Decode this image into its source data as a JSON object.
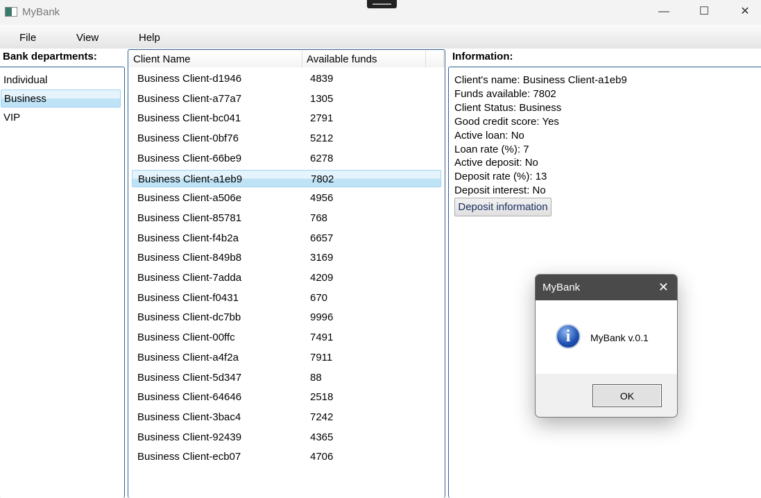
{
  "window": {
    "title": "MyBank",
    "minimize": "—",
    "maximize": "☐",
    "close": "✕"
  },
  "menu": [
    "File",
    "View",
    "Help"
  ],
  "departments": {
    "header": "Bank departments:",
    "items": [
      "Individual",
      "Business",
      "VIP"
    ],
    "selected": 1
  },
  "clients": {
    "columns": [
      "Client Name",
      "Available funds"
    ],
    "selected": 5,
    "rows": [
      [
        "Business Client-d1946",
        "4839"
      ],
      [
        "Business Client-a77a7",
        "1305"
      ],
      [
        "Business Client-bc041",
        "2791"
      ],
      [
        "Business Client-0bf76",
        "5212"
      ],
      [
        "Business Client-66be9",
        "6278"
      ],
      [
        "Business Client-a1eb9",
        "7802"
      ],
      [
        "Business Client-a506e",
        "4956"
      ],
      [
        "Business Client-85781",
        "768"
      ],
      [
        "Business Client-f4b2a",
        "6657"
      ],
      [
        "Business Client-849b8",
        "3169"
      ],
      [
        "Business Client-7adda",
        "4209"
      ],
      [
        "Business Client-f0431",
        "670"
      ],
      [
        "Business Client-dc7bb",
        "9996"
      ],
      [
        "Business Client-00ffc",
        "7491"
      ],
      [
        "Business Client-a4f2a",
        "7911"
      ],
      [
        "Business Client-5d347",
        "88"
      ],
      [
        "Business Client-64646",
        "2518"
      ],
      [
        "Business Client-3bac4",
        "7242"
      ],
      [
        "Business Client-92439",
        "4365"
      ],
      [
        "Business Client-ecb07",
        "4706"
      ]
    ]
  },
  "information": {
    "header": "Information:",
    "lines": [
      "Client's name: Business Client-a1eb9",
      "Funds available: 7802",
      "Client Status: Business",
      "Good credit score: Yes",
      "Active loan: No",
      "Loan rate (%): 7",
      "Active deposit: No",
      "Deposit rate (%): 13",
      "Deposit interest: No"
    ],
    "button": "Deposit information"
  },
  "dialog": {
    "title": "MyBank",
    "close": "✕",
    "icon": "i",
    "message": "MyBank v.0.1",
    "ok": "OK"
  }
}
